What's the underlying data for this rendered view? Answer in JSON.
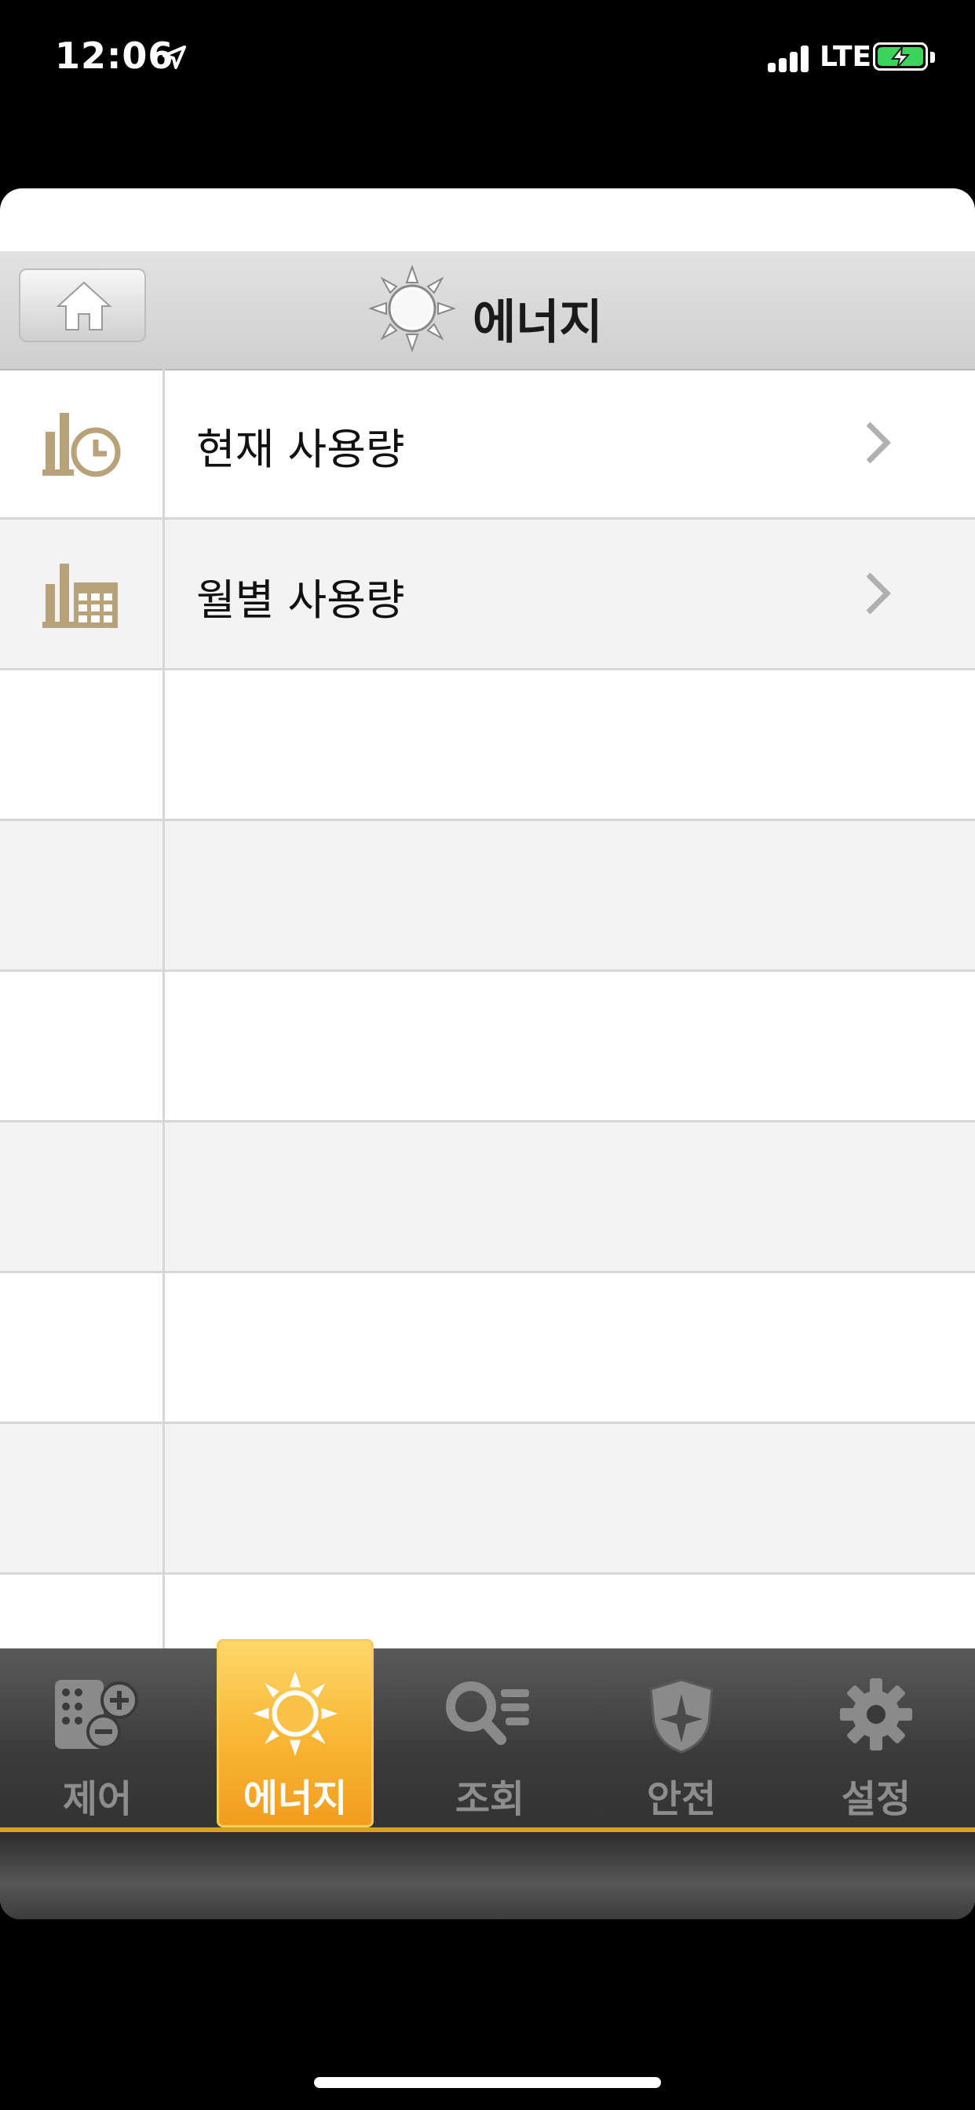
{
  "status_bar": {
    "time": "12:06",
    "network": "LTE",
    "icons": [
      "location-arrow-icon",
      "signal-icon",
      "battery-charging-icon"
    ]
  },
  "header": {
    "title": "에너지",
    "icons": [
      "home-icon",
      "sun-icon"
    ]
  },
  "menu": {
    "items": [
      {
        "label": "현재 사용량",
        "icon": "usage-clock-icon"
      },
      {
        "label": "월별 사용량",
        "icon": "usage-calendar-icon"
      }
    ]
  },
  "tabbar": {
    "active": "에너지",
    "items": [
      {
        "label": "제어",
        "icon": "remote-control-icon"
      },
      {
        "label": "에너지",
        "icon": "sun-icon"
      },
      {
        "label": "조회",
        "icon": "search-list-icon"
      },
      {
        "label": "안전",
        "icon": "shield-icon"
      },
      {
        "label": "설정",
        "icon": "gear-icon"
      }
    ]
  },
  "colors": {
    "accent": "#f9b836",
    "icon_gold": "#b8a27a",
    "tabbar_bg": "#3a3a3a"
  }
}
